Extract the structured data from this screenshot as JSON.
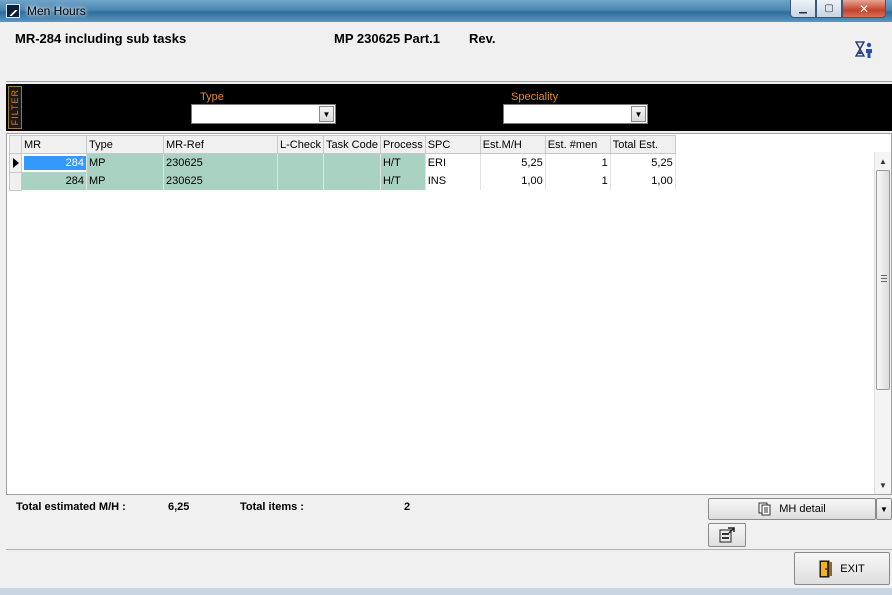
{
  "window": {
    "title": "Men Hours"
  },
  "header": {
    "mr_text": "MR-284 including sub tasks",
    "mp_text": "MP 230625 Part.1",
    "rev_text": "Rev."
  },
  "filter": {
    "tag": "FILTER",
    "type_label": "Type",
    "type_value": "",
    "speciality_label": "Speciality",
    "speciality_value": ""
  },
  "grid": {
    "columns": [
      "MR",
      "Type",
      "MR-Ref",
      "L-Check",
      "Task Code",
      "Process",
      "SPC",
      "Est.M/H",
      "Est. #men",
      "Total Est."
    ],
    "rows": [
      {
        "mr": "284",
        "type": "MP",
        "mr_ref": "230625",
        "l_check": "",
        "task_code": "",
        "process": "H/T",
        "spc": "ERI",
        "est_mh": "5,25",
        "est_men": "1",
        "total_est": "5,25"
      },
      {
        "mr": "284",
        "type": "MP",
        "mr_ref": "230625",
        "l_check": "",
        "task_code": "",
        "process": "H/T",
        "spc": "INS",
        "est_mh": "1,00",
        "est_men": "1",
        "total_est": "1,00"
      }
    ]
  },
  "footer": {
    "total_mh_label": "Total estimated M/H :",
    "total_mh_value": "6,25",
    "total_items_label": "Total items :",
    "total_items_value": "2",
    "mh_detail_label": "MH detail",
    "exit_label": "EXIT"
  },
  "icons": {
    "app": "app-window-icon",
    "hourglass": "hourglass-person-icon",
    "mh_detail": "documents-icon",
    "report": "report-icon",
    "exit": "door-exit-icon"
  },
  "colors": {
    "row_highlight": "#a9d2c3",
    "selection": "#3399ff",
    "filter_bar": "#000000",
    "filter_label": "#e8882c"
  }
}
